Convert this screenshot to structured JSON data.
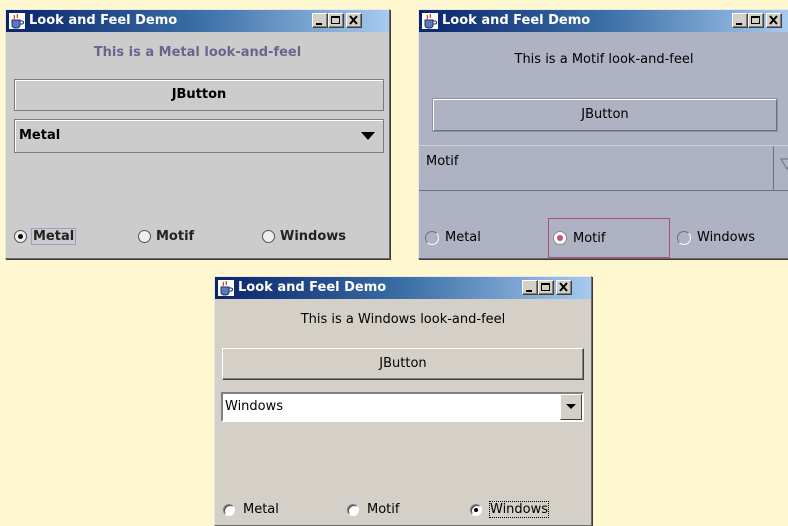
{
  "windows": {
    "metal": {
      "title": "Look and Feel Demo",
      "label": "This is a Metal look-and-feel",
      "button": "JButton",
      "combo_value": "Metal",
      "radios": [
        "Metal",
        "Motif",
        "Windows"
      ],
      "selected": "Metal"
    },
    "motif": {
      "title": "Look and Feel Demo",
      "label": "This is a Motif look-and-feel",
      "button": "JButton",
      "combo_value": "Motif",
      "radios": [
        "Metal",
        "Motif",
        "Windows"
      ],
      "selected": "Motif"
    },
    "windows": {
      "title": "Look and Feel Demo",
      "label": "This is a Windows look-and-feel",
      "button": "JButton",
      "combo_value": "Windows",
      "radios": [
        "Metal",
        "Motif",
        "Windows"
      ],
      "selected": "Windows"
    }
  },
  "icons": {
    "title": "java-cup-icon",
    "minimize": "minimize-icon",
    "maximize": "maximize-icon",
    "close": "close-icon",
    "combo": "chevron-down-icon"
  },
  "colors": {
    "page_background": "#FFF7D0",
    "metal_background": "#CCCCCC",
    "metal_label_text": "#66668F",
    "motif_background": "#AEB2C3",
    "motif_selected_radio": "#C0507A",
    "windows_background": "#D4D0C8",
    "titlebar_start": "#0A246A",
    "titlebar_end": "#A6CAF0"
  }
}
